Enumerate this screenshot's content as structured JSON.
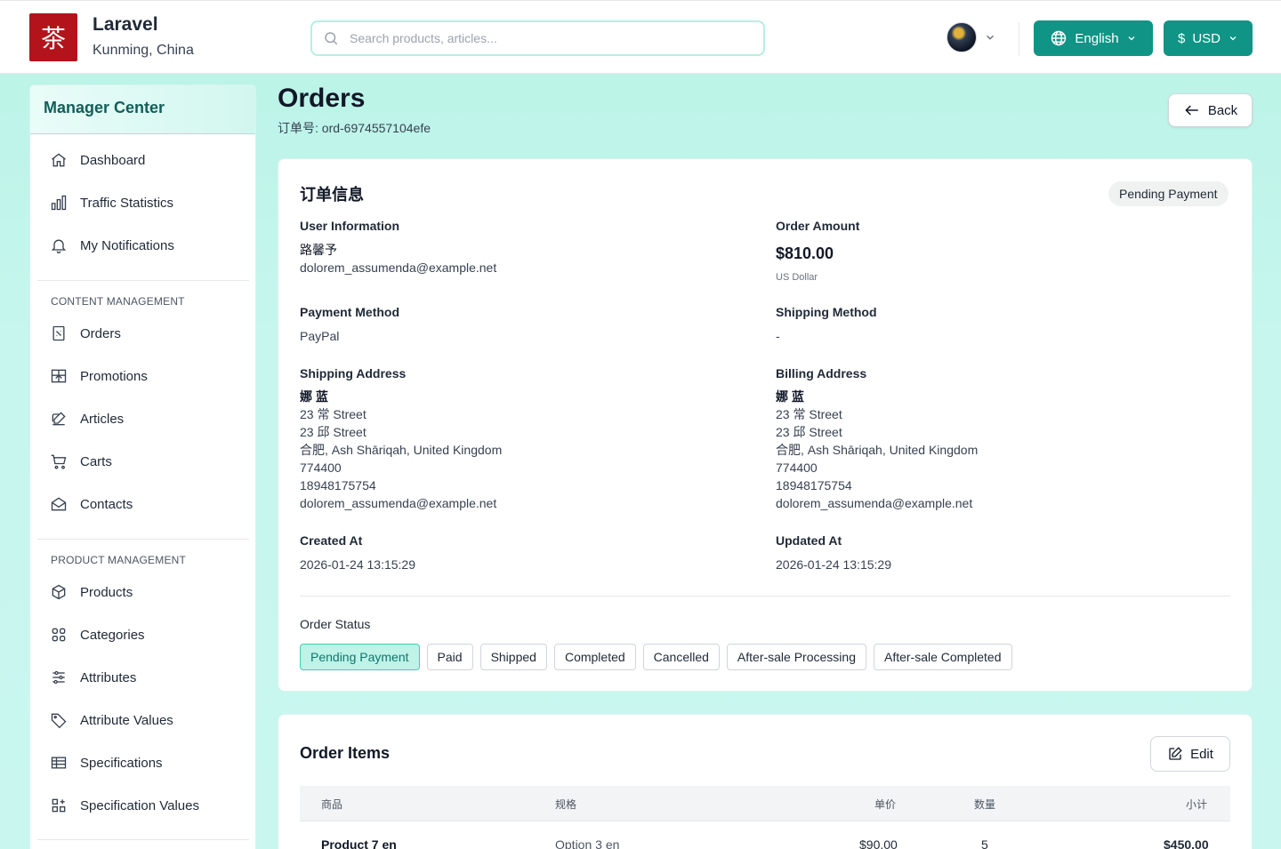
{
  "header": {
    "logo_glyph": "茶",
    "brand_name": "Laravel",
    "brand_location": "Kunming, China",
    "search_placeholder": "Search products, articles...",
    "language_label": "English",
    "currency_symbol": "$",
    "currency_label": "USD"
  },
  "sidebar": {
    "title": "Manager Center",
    "top_items": [
      {
        "label": "Dashboard",
        "icon": "home-icon"
      },
      {
        "label": "Traffic Statistics",
        "icon": "bar-chart-icon"
      },
      {
        "label": "My Notifications",
        "icon": "bell-icon"
      }
    ],
    "content_section": "CONTENT MANAGEMENT",
    "content_items": [
      {
        "label": "Orders",
        "icon": "receipt-icon"
      },
      {
        "label": "Promotions",
        "icon": "gift-icon"
      },
      {
        "label": "Articles",
        "icon": "pencil-square-icon"
      },
      {
        "label": "Carts",
        "icon": "cart-icon"
      },
      {
        "label": "Contacts",
        "icon": "envelope-icon"
      }
    ],
    "product_section": "PRODUCT MANAGEMENT",
    "product_items": [
      {
        "label": "Products",
        "icon": "cube-icon"
      },
      {
        "label": "Categories",
        "icon": "grid-icon"
      },
      {
        "label": "Attributes",
        "icon": "sliders-icon"
      },
      {
        "label": "Attribute Values",
        "icon": "tag-icon"
      },
      {
        "label": "Specifications",
        "icon": "table-icon"
      },
      {
        "label": "Specification Values",
        "icon": "blocks-icon"
      }
    ]
  },
  "page": {
    "title": "Orders",
    "order_number": "订单号: ord-6974557104efe",
    "back_label": "Back"
  },
  "order_info": {
    "title": "订单信息",
    "status_badge": "Pending Payment",
    "user_info_label": "User Information",
    "user_name": "路馨予",
    "user_email": "dolorem_assumenda@example.net",
    "amount_label": "Order Amount",
    "amount": "$810.00",
    "amount_currency": "US Dollar",
    "payment_label": "Payment Method",
    "payment_value": "PayPal",
    "shipping_method_label": "Shipping Method",
    "shipping_method_value": "-",
    "shipping_address_label": "Shipping Address",
    "billing_address_label": "Billing Address",
    "address": {
      "name": "娜 蓝",
      "line1": "23 常 Street",
      "line2": "23 邱 Street",
      "city_line": "合肥, Ash Shāriqah, United Kingdom",
      "postcode": "774400",
      "phone": "18948175754",
      "email": "dolorem_assumenda@example.net"
    },
    "created_label": "Created At",
    "created_value": "2026-01-24 13:15:29",
    "updated_label": "Updated At",
    "updated_value": "2026-01-24 13:15:29",
    "status_label": "Order Status",
    "statuses": [
      "Pending Payment",
      "Paid",
      "Shipped",
      "Completed",
      "Cancelled",
      "After-sale Processing",
      "After-sale Completed"
    ],
    "active_status": "Pending Payment"
  },
  "order_items": {
    "title": "Order Items",
    "edit_label": "Edit",
    "columns": [
      "商品",
      "规格",
      "单价",
      "数量",
      "小计"
    ],
    "rows": [
      {
        "product": "Product 7 en",
        "spec": "Option 3 en",
        "price": "$90.00",
        "qty": "5",
        "subtotal": "$450.00"
      }
    ]
  },
  "colors": {
    "accent": "#0f9486",
    "page_bg": "#c6f6ee",
    "logo_bg": "#b3141b",
    "active_status_bg": "#bff3e8"
  }
}
